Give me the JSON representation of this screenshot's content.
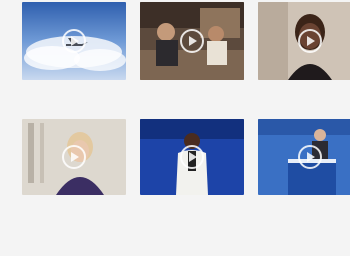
{
  "videos": [
    {
      "title": "",
      "meta": "",
      "thumbnail": "airplane-above-clouds",
      "colors": {
        "sky": "#5b8fd6",
        "cloud": "#e6eef8"
      }
    },
    {
      "title": "",
      "meta": "",
      "thumbnail": "people-at-counter",
      "colors": {
        "bg": "#6a5547",
        "accent": "#d9c2a6"
      }
    },
    {
      "title": "",
      "meta": "",
      "thumbnail": "woman-portrait",
      "colors": {
        "bg": "#c9b8a8",
        "skin": "#5b3a2b"
      }
    },
    {
      "title": "",
      "meta": "",
      "thumbnail": "woman-speaking",
      "colors": {
        "bg": "#d8d2c8",
        "dress": "#3a2f5a"
      }
    },
    {
      "title": "",
      "meta": "",
      "thumbnail": "man-on-stage",
      "colors": {
        "bg": "#1a3f9a",
        "suit": "#f0f0ec"
      }
    },
    {
      "title": "",
      "meta": "",
      "thumbnail": "speaker-at-podium",
      "colors": {
        "bg": "#3b6fc0",
        "podium": "#2252a8"
      }
    }
  ]
}
